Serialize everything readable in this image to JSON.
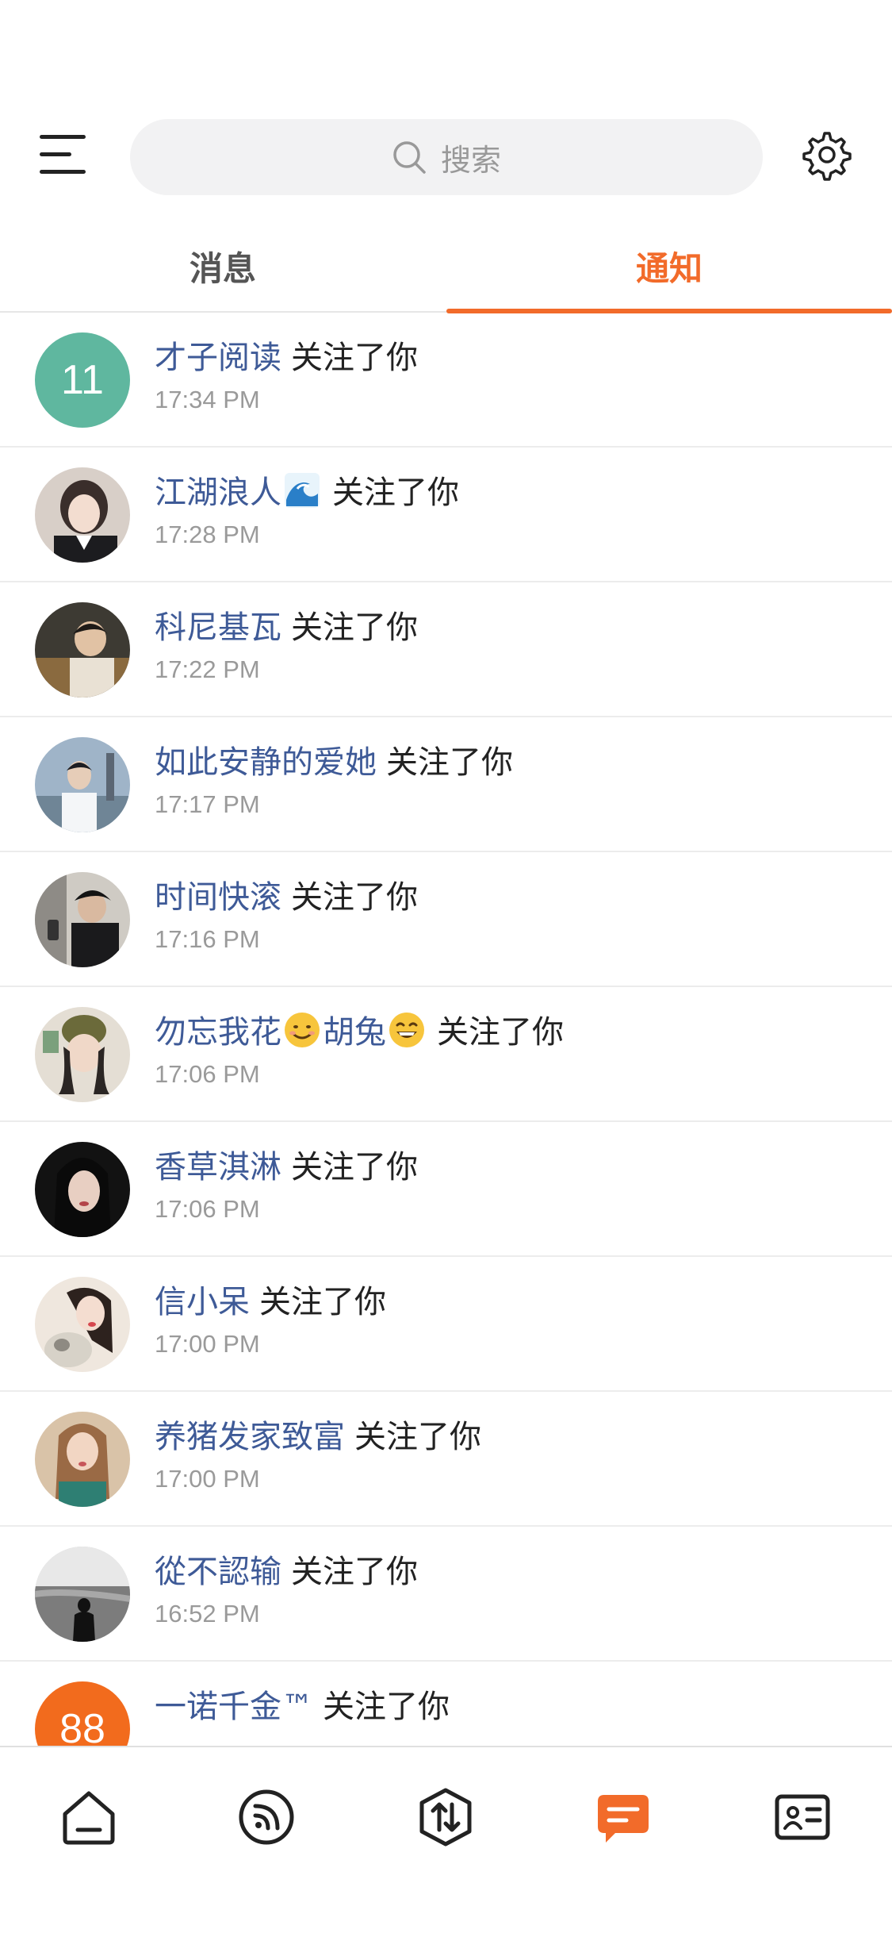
{
  "header": {
    "search": {
      "placeholder": "搜索",
      "icon": "search-icon"
    },
    "menu_icon": "hamburger-menu-icon",
    "settings_icon": "gear-icon"
  },
  "tabs": [
    {
      "label": "消息",
      "active": false
    },
    {
      "label": "通知",
      "active": true
    }
  ],
  "colors": {
    "accent": "#f26b2a",
    "username": "#3e5a97",
    "timestamp": "#9a9a9a"
  },
  "notifications": [
    {
      "name": "才子阅读",
      "action": "关注了你",
      "time": "17:34 PM",
      "avatar_text": "11",
      "avatar_color": "#5fb79f"
    },
    {
      "name": "江湖浪人",
      "name_emoji": "wave",
      "action": "关注了你",
      "time": "17:28 PM"
    },
    {
      "name": "科尼基瓦",
      "action": "关注了你",
      "time": "17:22 PM"
    },
    {
      "name": "如此安静的爱她",
      "action": "关注了你",
      "time": "17:17 PM"
    },
    {
      "name": "时间快滚",
      "action": "关注了你",
      "time": "17:16 PM"
    },
    {
      "name_part1": "勿忘我花",
      "name_part2": "胡兔",
      "action": "关注了你",
      "time": "17:06 PM"
    },
    {
      "name": "香草淇淋",
      "action": "关注了你",
      "time": "17:06 PM"
    },
    {
      "name": "信小呆",
      "action": "关注了你",
      "time": "17:00 PM"
    },
    {
      "name": "养猪发家致富",
      "action": "关注了你",
      "time": "17:00 PM"
    },
    {
      "name": "從不認输",
      "action": "关注了你",
      "time": "16:52 PM"
    },
    {
      "name": "一诺千金™",
      "action": "关注了你",
      "avatar_text": "88",
      "avatar_color": "#f26b1d"
    }
  ],
  "bottom_nav": [
    {
      "icon": "home-icon",
      "active": false
    },
    {
      "icon": "feed-icon",
      "active": false
    },
    {
      "icon": "exchange-icon",
      "active": false
    },
    {
      "icon": "message-icon",
      "active": true
    },
    {
      "icon": "contact-card-icon",
      "active": false
    }
  ]
}
